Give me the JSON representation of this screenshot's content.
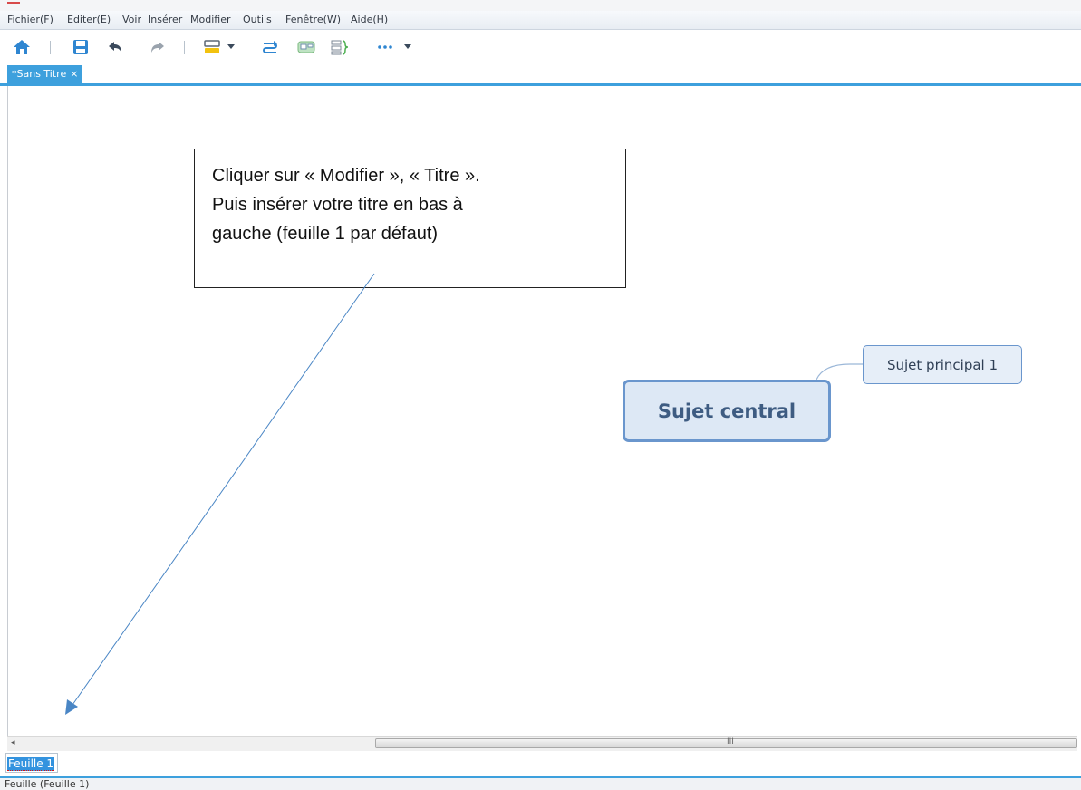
{
  "menu": {
    "items": [
      {
        "label": "Fichier(F)"
      },
      {
        "label": "Editer(E)"
      },
      {
        "label": "Voir"
      },
      {
        "label": "Insérer"
      },
      {
        "label": "Modifier"
      },
      {
        "label": "Outils"
      },
      {
        "label": "Fenêtre(W)"
      },
      {
        "label": "Aide(H)"
      }
    ]
  },
  "toolbar": {
    "icons": [
      "home-icon",
      "save-icon",
      "undo-icon",
      "redo-icon",
      "topic-style-icon",
      "dropdown-icon",
      "relationship-icon",
      "boundary-icon",
      "summary-icon",
      "more-icon",
      "dropdown-icon"
    ]
  },
  "tabs": {
    "document_label": "*Sans Titre",
    "close_glyph": "×"
  },
  "canvas": {
    "callout_lines": [
      "Cliquer sur « Modifier », « Titre ».",
      "Puis insérer votre titre en bas à",
      "gauche (feuille 1 par défaut)"
    ],
    "central_topic": "Sujet central",
    "subtopic": "Sujet principal  1"
  },
  "scrollbar": {
    "left_arrow": "◂",
    "grip": "III"
  },
  "sheet": {
    "tab_label": "Feuille  1"
  },
  "status": {
    "text": "Feuille (Feuille  1)"
  },
  "colors": {
    "accent": "#3da0dd",
    "topic_border": "#6a96cd",
    "topic_fill": "#dde8f5",
    "topic_text": "#3e5c82",
    "arrow": "#4a86c5"
  }
}
